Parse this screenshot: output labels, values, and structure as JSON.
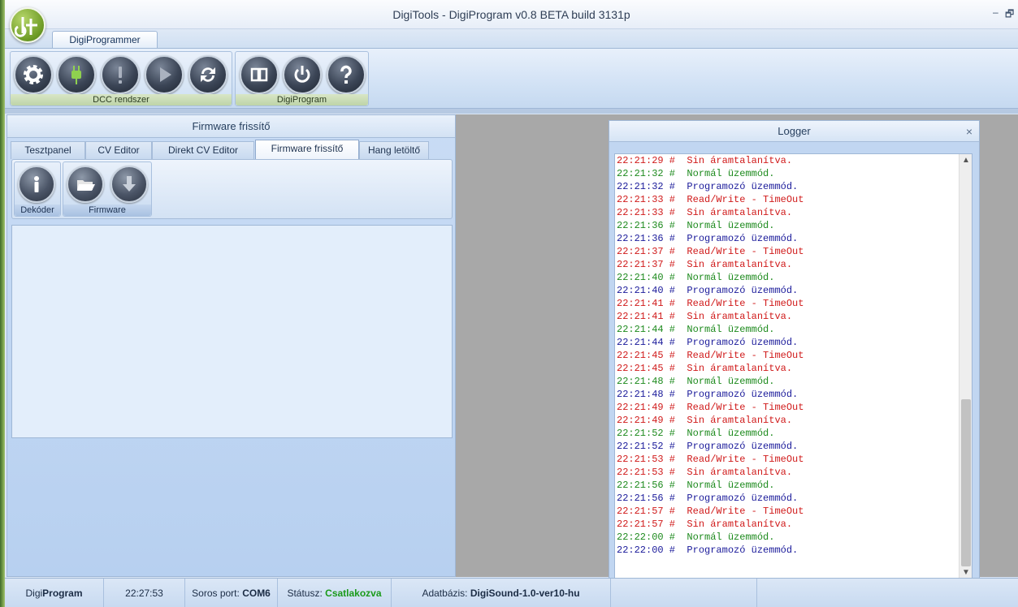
{
  "window": {
    "title": "DigiTools - DigiProgram v0.8 BETA build 3131p",
    "minimize_glyph": "–",
    "restore_glyph": "🗗"
  },
  "ribbon": {
    "tab_label": "DigiProgrammer",
    "right_glyph": "(",
    "groups": [
      {
        "label": "DCC rendszer",
        "buttons": [
          "gear-icon",
          "plug-icon",
          "exclamation-icon",
          "play-icon",
          "refresh-icon"
        ]
      },
      {
        "label": "DigiProgram",
        "buttons": [
          "columns-icon",
          "power-icon",
          "help-icon"
        ]
      }
    ]
  },
  "left_panel": {
    "title": "Firmware frissítő",
    "tabs": [
      {
        "label": "Tesztpanel"
      },
      {
        "label": "CV Editor"
      },
      {
        "label": "Direkt CV Editor"
      },
      {
        "label": "Firmware frissítő",
        "active": true
      },
      {
        "label": "Hang letöltő"
      }
    ],
    "groups": [
      {
        "label": "Dekóder",
        "buttons": [
          "info-icon"
        ]
      },
      {
        "label": "Firmware",
        "buttons": [
          "folder-open-icon",
          "download-icon"
        ]
      }
    ]
  },
  "logger": {
    "title": "Logger",
    "close_glyph": "×",
    "colors": {
      "red": "#d01a1a",
      "green": "#1d8a1d",
      "blue": "#1a1a9a"
    },
    "lines": [
      {
        "time": "22:21:29",
        "msg": "Sin áramtalanítva.",
        "color": "red"
      },
      {
        "time": "22:21:32",
        "msg": "Normál üzemmód.",
        "color": "green"
      },
      {
        "time": "22:21:32",
        "msg": "Programozó üzemmód.",
        "color": "blue"
      },
      {
        "time": "22:21:33",
        "msg": "Read/Write - TimeOut",
        "color": "red"
      },
      {
        "time": "22:21:33",
        "msg": "Sin áramtalanítva.",
        "color": "red"
      },
      {
        "time": "22:21:36",
        "msg": "Normál üzemmód.",
        "color": "green"
      },
      {
        "time": "22:21:36",
        "msg": "Programozó üzemmód.",
        "color": "blue"
      },
      {
        "time": "22:21:37",
        "msg": "Read/Write - TimeOut",
        "color": "red"
      },
      {
        "time": "22:21:37",
        "msg": "Sin áramtalanítva.",
        "color": "red"
      },
      {
        "time": "22:21:40",
        "msg": "Normál üzemmód.",
        "color": "green"
      },
      {
        "time": "22:21:40",
        "msg": "Programozó üzemmód.",
        "color": "blue"
      },
      {
        "time": "22:21:41",
        "msg": "Read/Write - TimeOut",
        "color": "red"
      },
      {
        "time": "22:21:41",
        "msg": "Sin áramtalanítva.",
        "color": "red"
      },
      {
        "time": "22:21:44",
        "msg": "Normál üzemmód.",
        "color": "green"
      },
      {
        "time": "22:21:44",
        "msg": "Programozó üzemmód.",
        "color": "blue"
      },
      {
        "time": "22:21:45",
        "msg": "Read/Write - TimeOut",
        "color": "red"
      },
      {
        "time": "22:21:45",
        "msg": "Sin áramtalanítva.",
        "color": "red"
      },
      {
        "time": "22:21:48",
        "msg": "Normál üzemmód.",
        "color": "green"
      },
      {
        "time": "22:21:48",
        "msg": "Programozó üzemmód.",
        "color": "blue"
      },
      {
        "time": "22:21:49",
        "msg": "Read/Write - TimeOut",
        "color": "red"
      },
      {
        "time": "22:21:49",
        "msg": "Sin áramtalanítva.",
        "color": "red"
      },
      {
        "time": "22:21:52",
        "msg": "Normál üzemmód.",
        "color": "green"
      },
      {
        "time": "22:21:52",
        "msg": "Programozó üzemmód.",
        "color": "blue"
      },
      {
        "time": "22:21:53",
        "msg": "Read/Write - TimeOut",
        "color": "red"
      },
      {
        "time": "22:21:53",
        "msg": "Sin áramtalanítva.",
        "color": "red"
      },
      {
        "time": "22:21:56",
        "msg": "Normál üzemmód.",
        "color": "green"
      },
      {
        "time": "22:21:56",
        "msg": "Programozó üzemmód.",
        "color": "blue"
      },
      {
        "time": "22:21:57",
        "msg": "Read/Write - TimeOut",
        "color": "red"
      },
      {
        "time": "22:21:57",
        "msg": "Sin áramtalanítva.",
        "color": "red"
      },
      {
        "time": "22:22:00",
        "msg": "Normál üzemmód.",
        "color": "green"
      },
      {
        "time": "22:22:00",
        "msg": "Programozó üzemmód.",
        "color": "blue"
      }
    ]
  },
  "statusbar": {
    "app_prefix": "Digi",
    "app_bold": "Program",
    "time": "22:27:53",
    "port_label": "Soros port:",
    "port_value": "COM6",
    "status_label": "Státusz:",
    "status_value": "Csatlakozva",
    "db_label": "Adatbázis:",
    "db_value": "DigiSound-1.0-ver10-hu"
  }
}
